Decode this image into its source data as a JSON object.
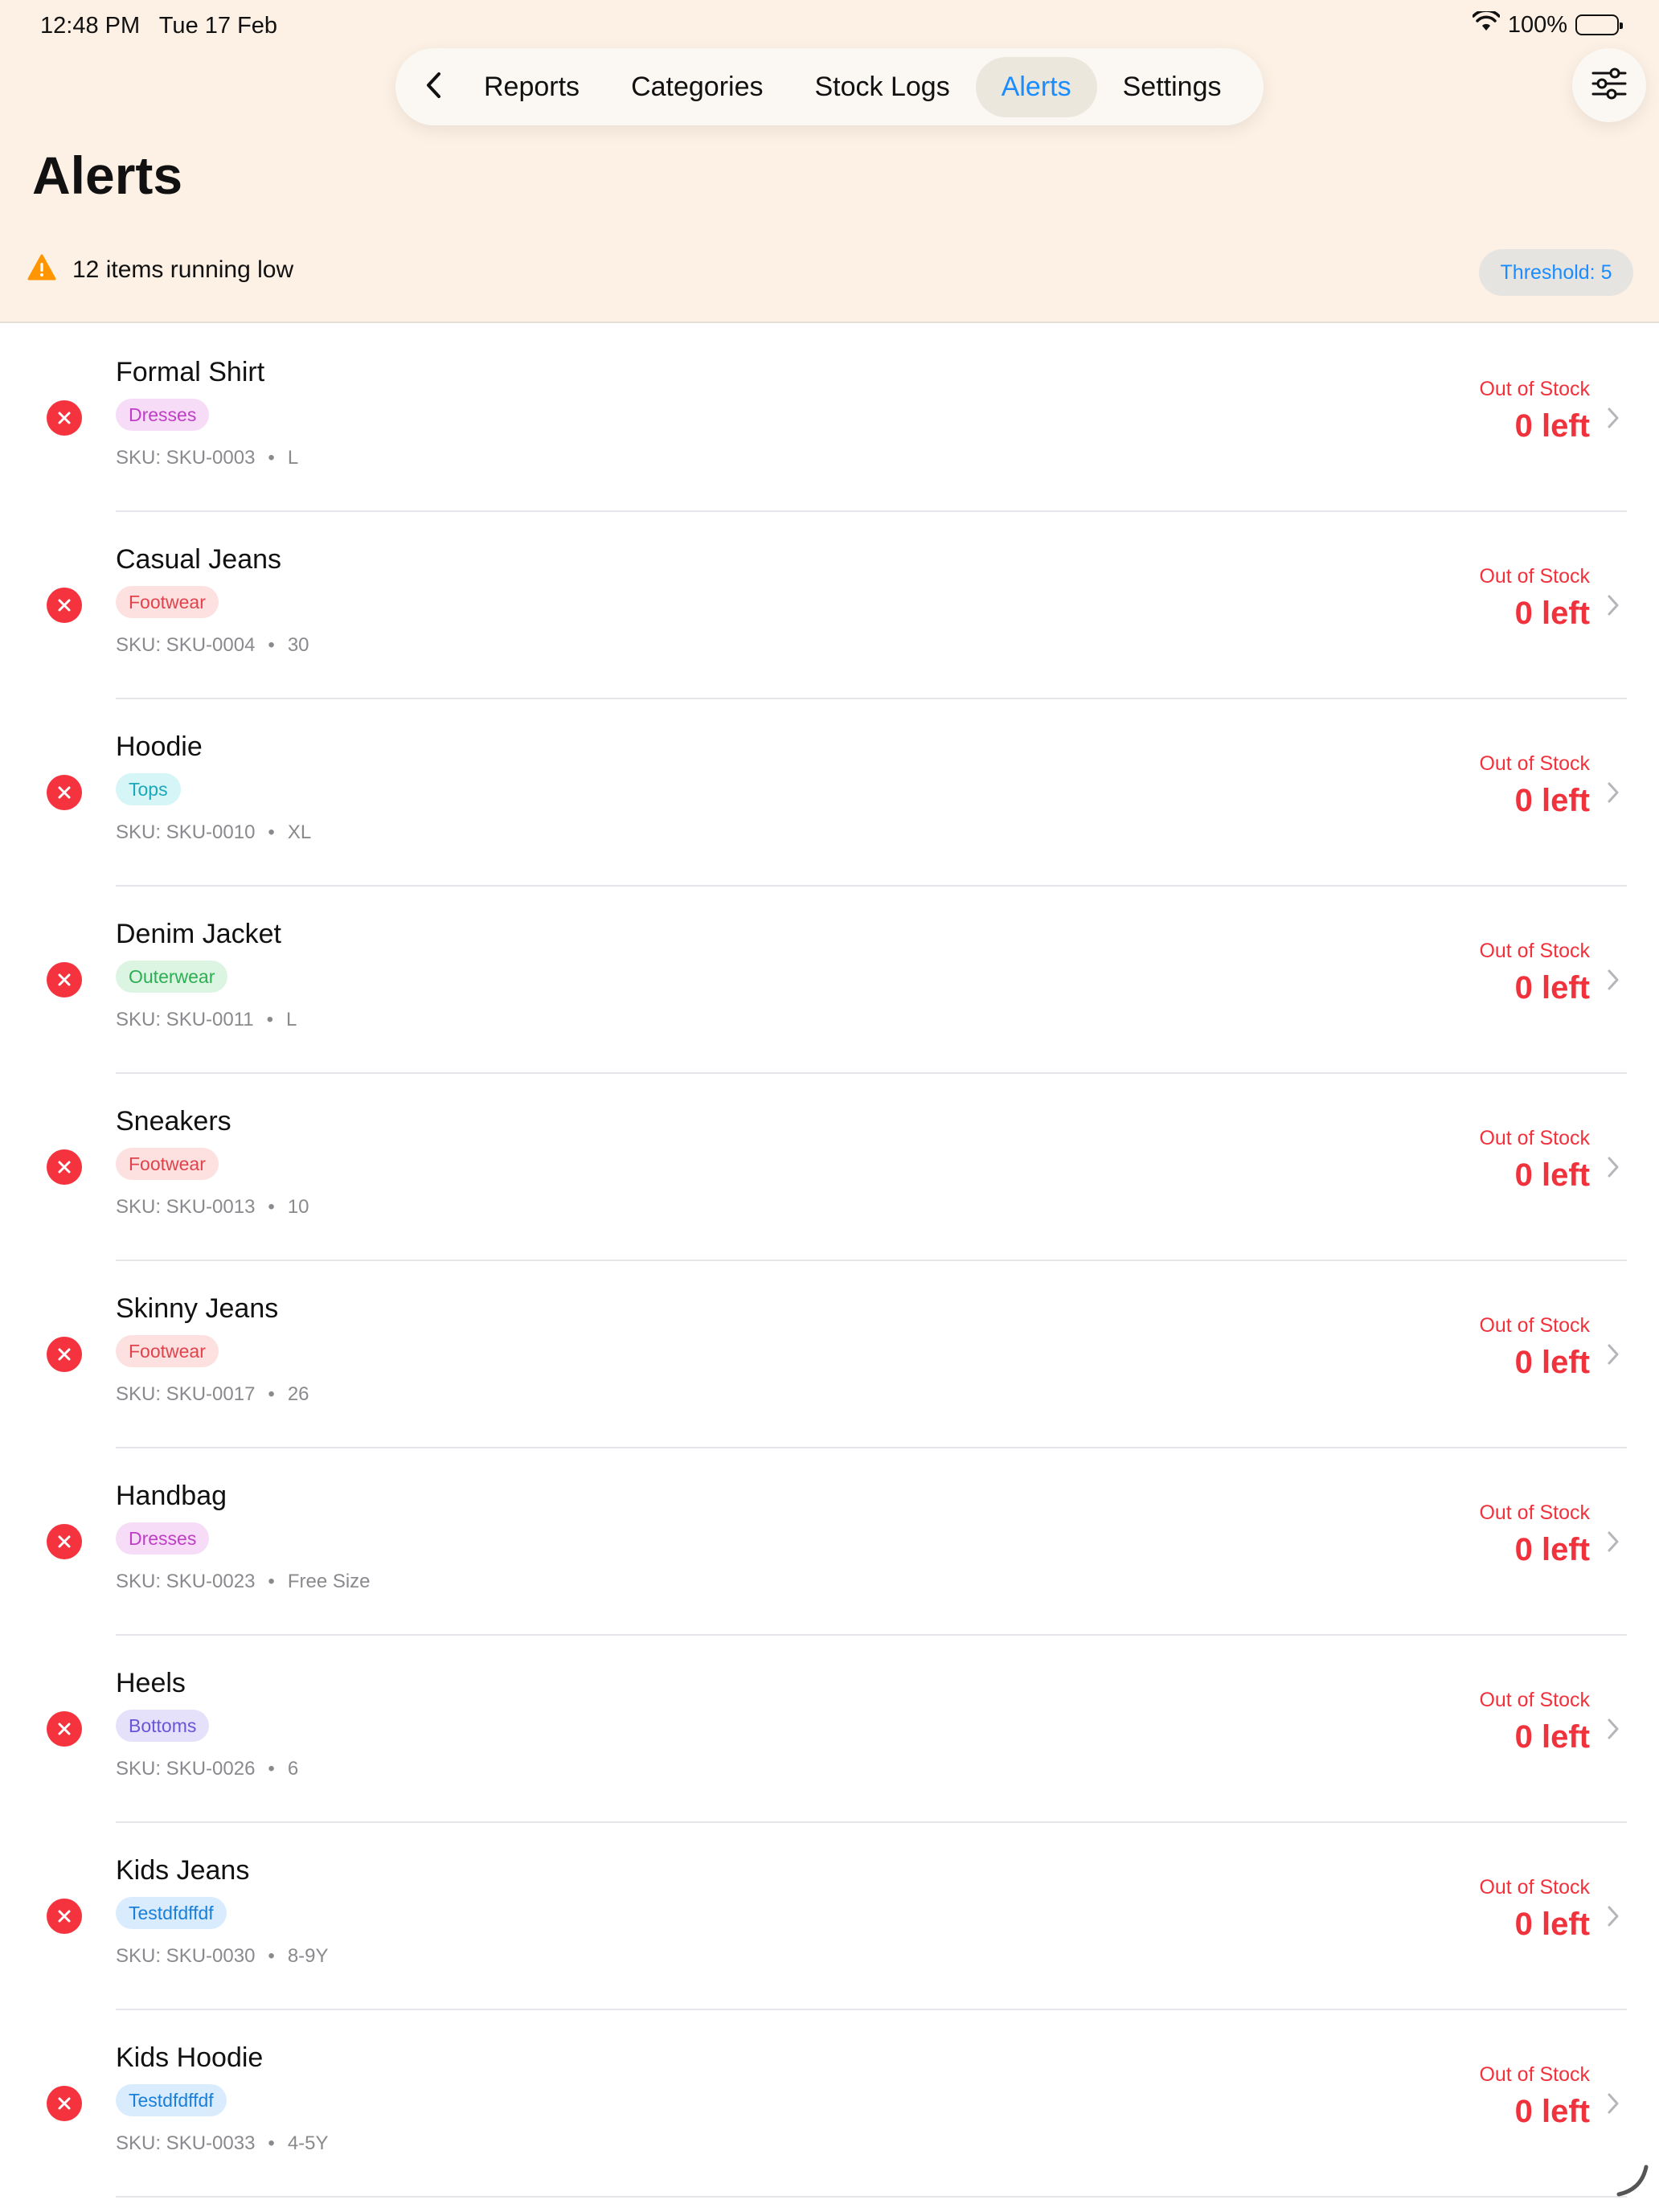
{
  "status_bar": {
    "time": "12:48 PM",
    "date": "Tue 17 Feb",
    "battery": "100%"
  },
  "nav": {
    "back_icon": "chevron-left-icon",
    "tabs": [
      {
        "label": "Reports",
        "active": false
      },
      {
        "label": "Categories",
        "active": false
      },
      {
        "label": "Stock Logs",
        "active": false
      },
      {
        "label": "Alerts",
        "active": true
      },
      {
        "label": "Settings",
        "active": false
      }
    ],
    "filter_icon": "sliders-icon"
  },
  "page": {
    "title": "Alerts",
    "summary": "12 items running low",
    "threshold": "Threshold: 5"
  },
  "colors": {
    "accent": "#1a8cff",
    "danger": "#f0323c",
    "warning": "#ff9500",
    "header_bg": "#fdf1e5"
  },
  "items": [
    {
      "name": "Formal Shirt",
      "category": "Dresses",
      "sku": "SKU: SKU-0003",
      "size": "L",
      "status": "Out of Stock",
      "qty": "0 left"
    },
    {
      "name": "Casual Jeans",
      "category": "Footwear",
      "sku": "SKU: SKU-0004",
      "size": "30",
      "status": "Out of Stock",
      "qty": "0 left"
    },
    {
      "name": "Hoodie",
      "category": "Tops",
      "sku": "SKU: SKU-0010",
      "size": "XL",
      "status": "Out of Stock",
      "qty": "0 left"
    },
    {
      "name": "Denim Jacket",
      "category": "Outerwear",
      "sku": "SKU: SKU-0011",
      "size": "L",
      "status": "Out of Stock",
      "qty": "0 left"
    },
    {
      "name": "Sneakers",
      "category": "Footwear",
      "sku": "SKU: SKU-0013",
      "size": "10",
      "status": "Out of Stock",
      "qty": "0 left"
    },
    {
      "name": "Skinny Jeans",
      "category": "Footwear",
      "sku": "SKU: SKU-0017",
      "size": "26",
      "status": "Out of Stock",
      "qty": "0 left"
    },
    {
      "name": "Handbag",
      "category": "Dresses",
      "sku": "SKU: SKU-0023",
      "size": "Free Size",
      "status": "Out of Stock",
      "qty": "0 left"
    },
    {
      "name": "Heels",
      "category": "Bottoms",
      "sku": "SKU: SKU-0026",
      "size": "6",
      "status": "Out of Stock",
      "qty": "0 left"
    },
    {
      "name": "Kids Jeans",
      "category": "Testdfdffdf",
      "sku": "SKU: SKU-0030",
      "size": "8-9Y",
      "status": "Out of Stock",
      "qty": "0 left"
    },
    {
      "name": "Kids Hoodie",
      "category": "Testdfdffdf",
      "sku": "SKU: SKU-0033",
      "size": "4-5Y",
      "status": "Out of Stock",
      "qty": "0 left"
    }
  ],
  "category_colors": {
    "Dresses": {
      "bg": "#f6dcf6",
      "fg": "#c03ec6"
    },
    "Footwear": {
      "bg": "#fde0e0",
      "fg": "#e0434b"
    },
    "Tops": {
      "bg": "#d6f5f7",
      "fg": "#1aa9b8"
    },
    "Outerwear": {
      "bg": "#dcf5e2",
      "fg": "#2eae54"
    },
    "Bottoms": {
      "bg": "#e6e1fb",
      "fg": "#6a54d8"
    },
    "Testdfdffdf": {
      "bg": "#d8ecfd",
      "fg": "#1a7fd8"
    }
  }
}
